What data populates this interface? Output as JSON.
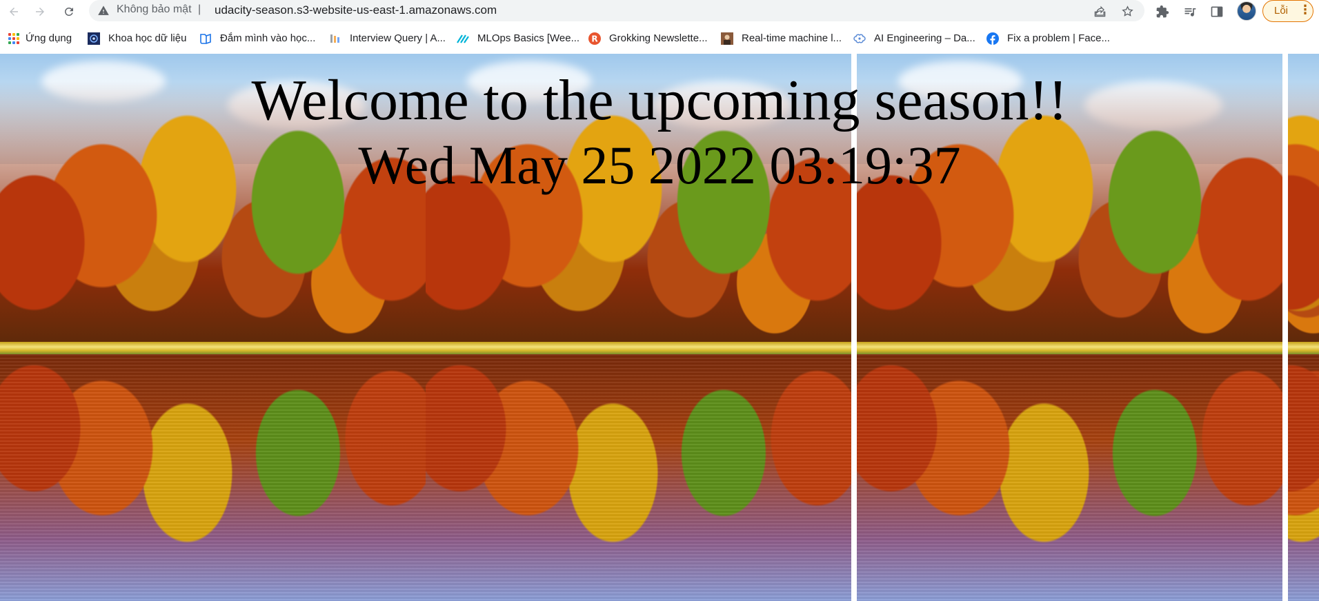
{
  "browser": {
    "address_bar": {
      "security_label": "Không bảo mật",
      "separator": "|",
      "url": "udacity-season.s3-website-us-east-1.amazonaws.com"
    },
    "profile": {
      "error_label": "Lỗi",
      "menu_glyph": "⋮"
    }
  },
  "bookmarks": [
    {
      "label": "Ứng dụng",
      "icon": "apps-grid-icon"
    },
    {
      "label": "Khoa học dữ liệu",
      "icon": "data-science-favicon"
    },
    {
      "label": "Đắm mình vào học...",
      "icon": "book-favicon"
    },
    {
      "label": "Interview Query | A...",
      "icon": "interview-query-favicon"
    },
    {
      "label": "MLOps Basics [Wee...",
      "icon": "mlops-favicon"
    },
    {
      "label": "Grokking Newslette...",
      "icon": "grokking-favicon"
    },
    {
      "label": "Real-time machine l...",
      "icon": "realtime-ml-favicon"
    },
    {
      "label": "AI Engineering – Da...",
      "icon": "ai-engineering-favicon"
    },
    {
      "label": "Fix a problem | Face...",
      "icon": "facebook-favicon"
    }
  ],
  "page": {
    "heading": "Welcome to the upcoming season!!",
    "datetime": "Wed May 25 2022 03:19:37"
  },
  "colors": {
    "omnibox_bg": "#f1f3f4",
    "error_accent": "#e37400",
    "facebook_blue": "#1877f2"
  }
}
